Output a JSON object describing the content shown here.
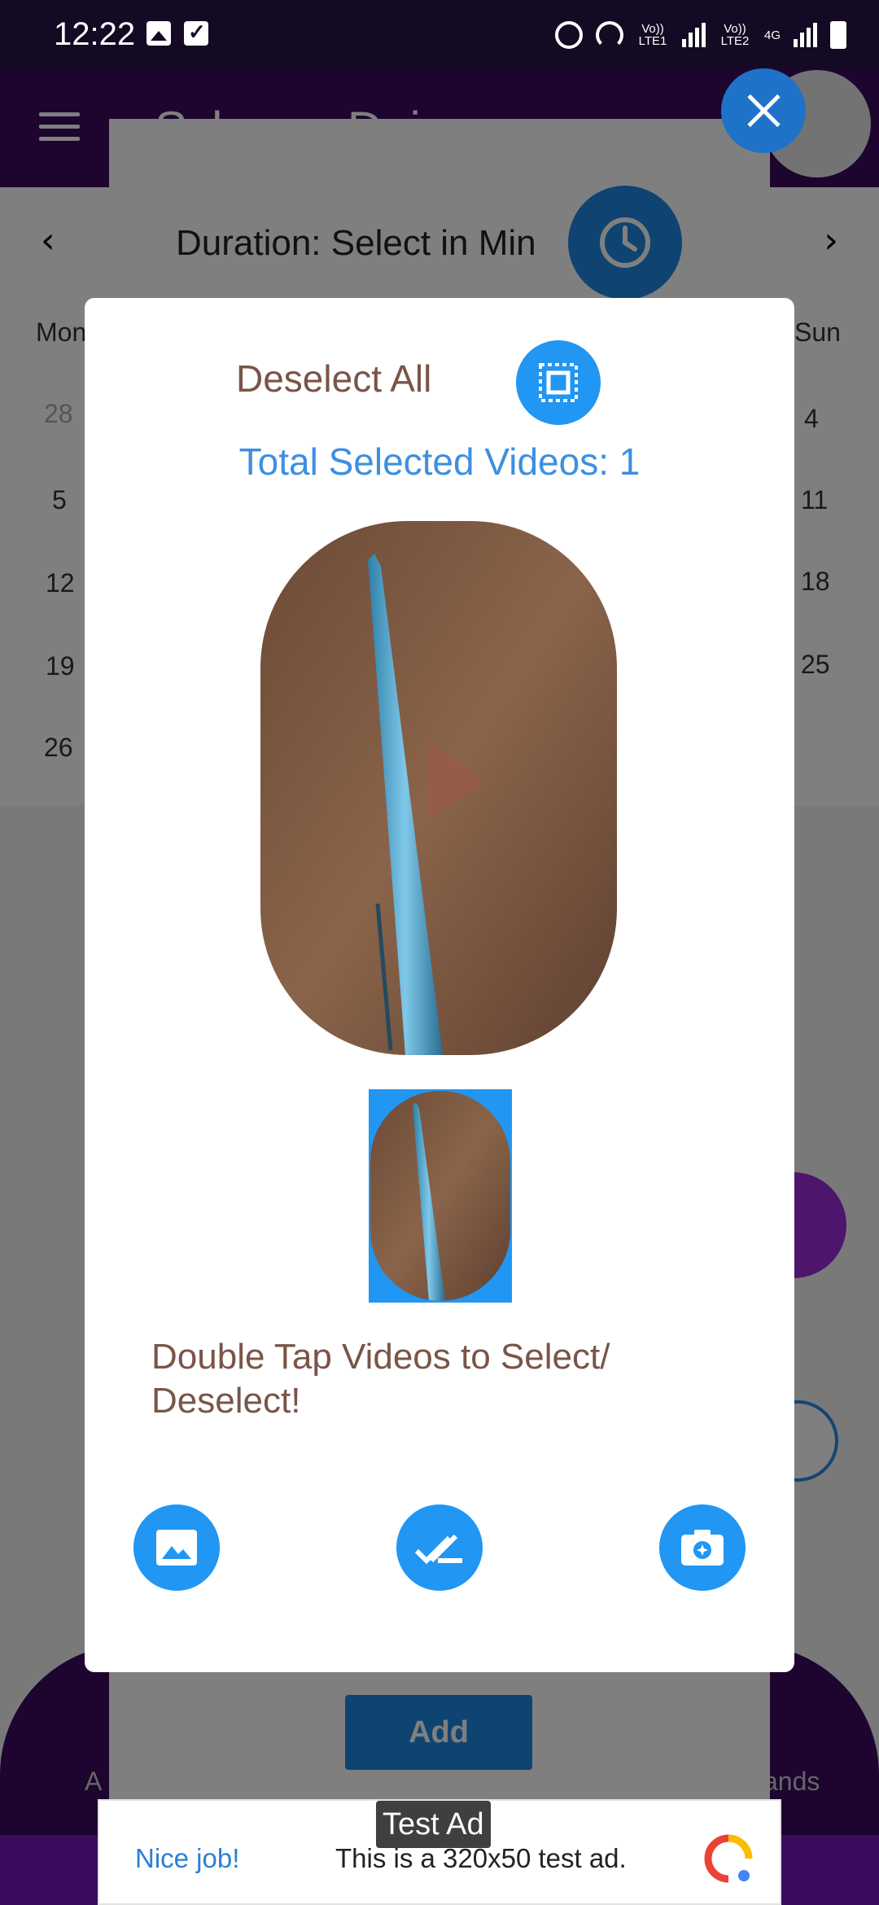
{
  "status_bar": {
    "time": "12:22",
    "net1": "Vo)) LTE1",
    "net2": "Vo)) LTE2",
    "net_type": "4G"
  },
  "background_app": {
    "title": "Scheme Doing",
    "duration_label": "Duration: Select in Min",
    "add_button": "Add",
    "calendar": {
      "day_left": "Mon",
      "day_right": "Sun",
      "dates_left": [
        "28",
        "5",
        "12",
        "19",
        "26"
      ],
      "dates_right": [
        "4",
        "11",
        "18",
        "25"
      ]
    },
    "bottom_left": "A",
    "bottom_right": "ands"
  },
  "dialog": {
    "deselect_label": "Deselect All",
    "total_selected": "Total Selected Videos: 1",
    "hint": "Double Tap Videos to Select/ Deselect!",
    "actions": {
      "gallery_icon": "image-icon",
      "confirm_icon": "double-check-icon",
      "camera_icon": "camera-icon"
    }
  },
  "ad": {
    "label": "Test Ad",
    "nice": "Nice job!",
    "text": "This is a 320x50 test ad."
  },
  "colors": {
    "primary": "#2196f3",
    "brown_text": "#795548",
    "blue_text": "#3d8fe0",
    "app_purple": "#3a0b5e"
  }
}
